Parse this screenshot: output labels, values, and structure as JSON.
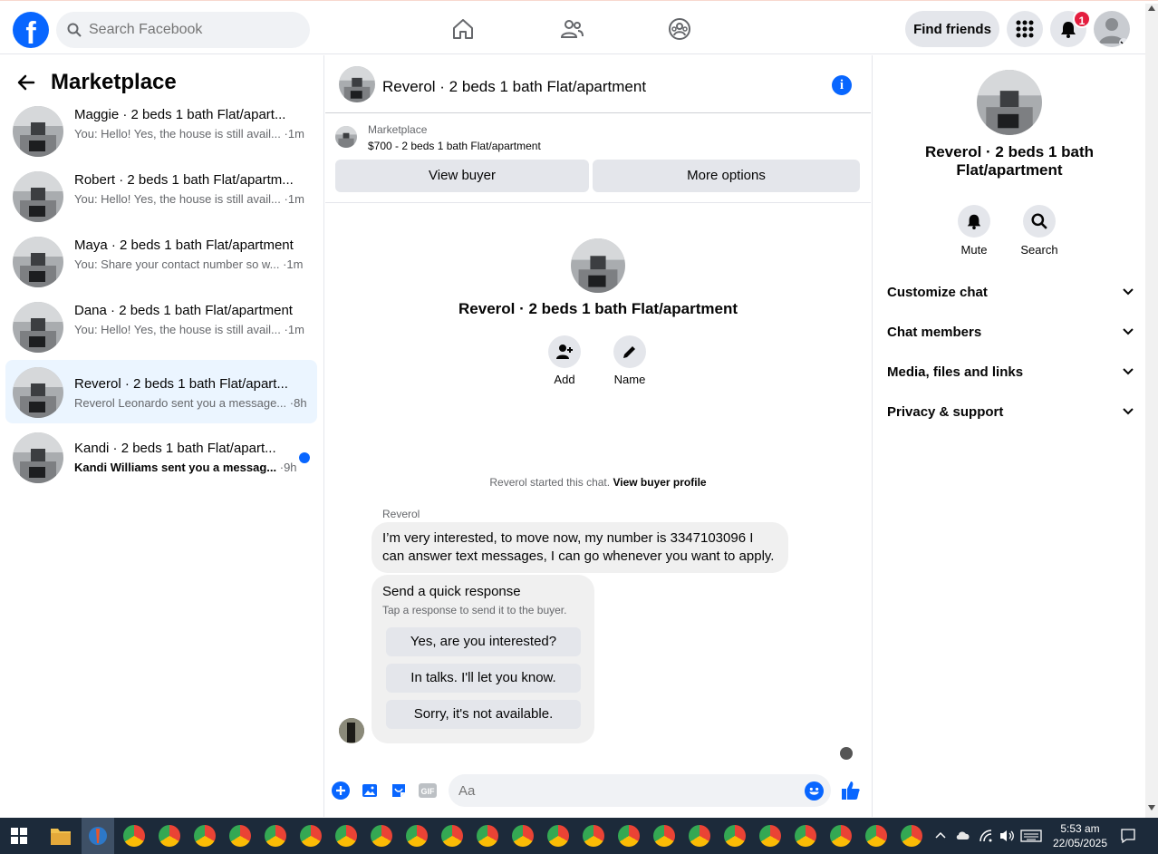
{
  "topbar": {
    "search_placeholder": "Search Facebook",
    "find_friends": "Find friends",
    "notification_count": "1"
  },
  "left": {
    "title": "Marketplace",
    "conversations": [
      {
        "title": "Maggie · 2 beds 1 bath Flat/apart...",
        "preview": "You: Hello! Yes, the house is still avail...",
        "time": "·1m",
        "unread": false
      },
      {
        "title": "Robert · 2 beds 1 bath Flat/apartm...",
        "preview": "You: Hello! Yes, the house is still avail...",
        "time": "·1m",
        "unread": false
      },
      {
        "title": "Maya · 2 beds 1 bath Flat/apartment",
        "preview": "You: Share your contact number so w...",
        "time": "·1m",
        "unread": false
      },
      {
        "title": "Dana · 2 beds 1 bath Flat/apartment",
        "preview": "You: Hello! Yes, the house is still avail...",
        "time": "·1m",
        "unread": false
      },
      {
        "title": "Reverol · 2 beds 1 bath Flat/apart...",
        "preview": "Reverol Leonardo sent you a message...",
        "time": "·8h",
        "unread": false
      },
      {
        "title": "Kandi · 2 beds 1 bath Flat/apart...",
        "preview": "Kandi Williams sent you a messag...",
        "time": "·9h",
        "unread": true
      }
    ]
  },
  "chat": {
    "header_title": "Reverol · 2 beds 1 bath Flat/apartment",
    "listing_source": "Marketplace",
    "listing_summary": "$700 - 2 beds 1 bath Flat/apartment",
    "view_buyer": "View buyer",
    "more_options": "More options",
    "center_title": "Reverol · 2 beds 1 bath Flat/apartment",
    "add_label": "Add",
    "name_label": "Name",
    "started_text": "Reverol started this chat.",
    "view_buyer_profile": "View buyer profile",
    "sender": "Reverol",
    "message": "I’m very interested, to move now, my number is 3347103096 I can answer text messages, I can go whenever you want to apply.",
    "quick_title": "Send a quick response",
    "quick_sub": "Tap a response to send it to the buyer.",
    "quick_responses": [
      "Yes, are you interested?",
      "In talks. I'll let you know.",
      "Sorry, it's not available."
    ],
    "composer_placeholder": "Aa"
  },
  "right": {
    "title": "Reverol · 2 beds 1 bath Flat/apartment",
    "mute": "Mute",
    "search": "Search",
    "sections": [
      "Customize chat",
      "Chat members",
      "Media, files and links",
      "Privacy & support"
    ]
  },
  "taskbar": {
    "time": "5:53 am",
    "date": "22/05/2025"
  },
  "colors": {
    "accent": "#0866ff",
    "badge": "#e41e3f",
    "active_row": "#ebf5ff"
  }
}
